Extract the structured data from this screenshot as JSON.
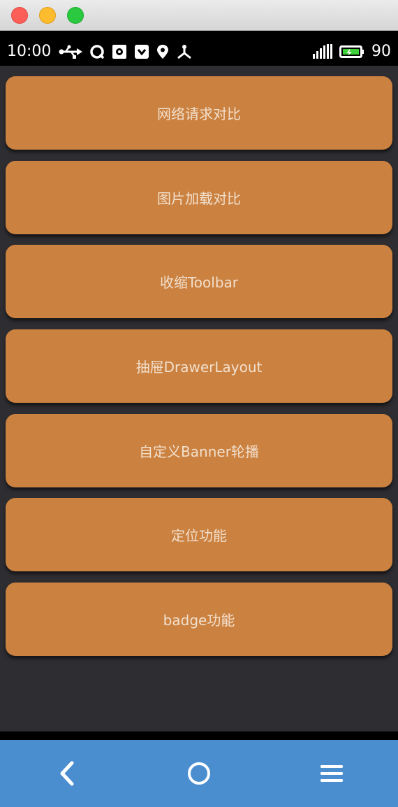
{
  "status_bar": {
    "time": "10:00",
    "battery_level": "90",
    "icons": [
      "usb-icon",
      "qq-icon",
      "notification-icon",
      "shield-icon",
      "location-pin-icon",
      "network-icon",
      "signal-icon",
      "battery-icon"
    ]
  },
  "menu": {
    "items": [
      {
        "label": "网络请求对比"
      },
      {
        "label": "图片加载对比"
      },
      {
        "label": "收缩Toolbar"
      },
      {
        "label": "抽屉DrawerLayout"
      },
      {
        "label": "自定义Banner轮播"
      },
      {
        "label": "定位功能"
      },
      {
        "label": "badge功能"
      }
    ]
  },
  "nav_bar": {
    "icons": [
      "back-icon",
      "home-icon",
      "menu-icon"
    ]
  },
  "colors": {
    "button_bg": "#cb8140",
    "button_text": "#f2e0cd",
    "content_bg": "#2e2d31",
    "nav_bg": "#4a8ecf"
  }
}
